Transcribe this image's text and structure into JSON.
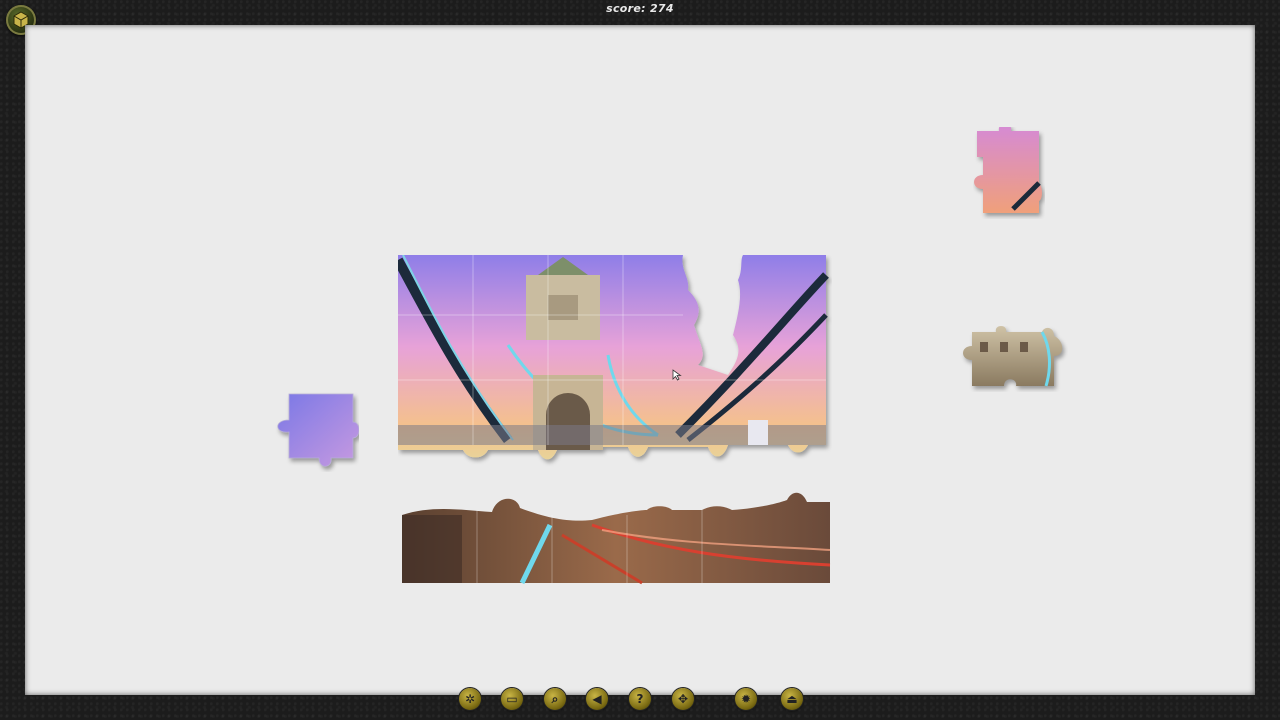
{
  "hud": {
    "score_text": "score: 274"
  },
  "toolbar": {
    "buttons": [
      {
        "name": "settings-button",
        "icon": "gear-icon",
        "glyph": "✲"
      },
      {
        "name": "preview-button",
        "icon": "picture-icon",
        "glyph": "▭"
      },
      {
        "name": "zoom-button",
        "icon": "magnifier-icon",
        "glyph": "⌕"
      },
      {
        "name": "undo-button",
        "icon": "back-arrow-icon",
        "glyph": "◀"
      },
      {
        "name": "help-button",
        "icon": "question-icon",
        "glyph": "?"
      },
      {
        "name": "shuffle-button",
        "icon": "pieces-icon",
        "glyph": "✥"
      },
      {
        "name": "options-button",
        "icon": "cog-icon",
        "glyph": "✹"
      },
      {
        "name": "exit-button",
        "icon": "exit-icon",
        "glyph": "⏏"
      }
    ]
  },
  "colors": {
    "board": "#ebebeb",
    "frame": "#1c1c1c",
    "sky_top": "#8f7ee8",
    "sky_mid": "#e7a2d8",
    "sky_low": "#f5c28a",
    "road": "#7a5a44"
  }
}
